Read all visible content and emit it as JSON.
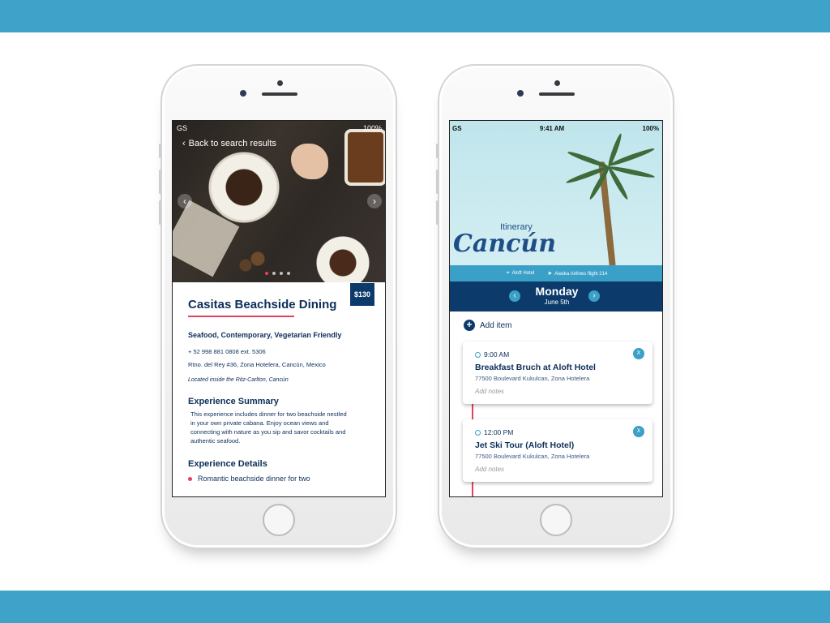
{
  "colors": {
    "band": "#3fa3c9",
    "navy": "#0c3b6b",
    "accent_pink": "#e6405f",
    "accent_blue": "#3aa0c8"
  },
  "phone1": {
    "status": {
      "carrier": "GS",
      "battery": "100%"
    },
    "back_label": "Back to search results",
    "carousel": {
      "total_slides": 4,
      "active_index": 0
    },
    "price": "$130",
    "title": "Casitas Beachside Dining",
    "cuisine": "Seafood, Contemporary, Vegetarian Friendly",
    "phone": "+ 52 998 881 0808 ext. 5306",
    "address": "Rtno. del Rey #36, Zona Hotelera, Cancún, Mexico",
    "location_note": "Located inside the Ritz-Carlton, Cancún",
    "summary_heading": "Experience Summary",
    "summary_text": "This experience includes dinner for two beachside nestled in your own private cabana. Enjoy ocean views and connecting with nature as you sip and savor cocktails and authentic seafood.",
    "details_heading": "Experience Details",
    "details": [
      "Romantic beachside dinner for two"
    ]
  },
  "phone2": {
    "status": {
      "carrier": "GS",
      "time": "9:41 AM",
      "battery": "100%"
    },
    "itinerary_label": "Itinerary",
    "city": "Cancún",
    "hotel": "Aloft Hotel",
    "flight": "Alaska Airlines flight 214",
    "day": {
      "name": "Monday",
      "date": "June 5th"
    },
    "add_item_label": "Add item",
    "items": [
      {
        "time": "9:00 AM",
        "title": "Breakfast Bruch at Aloft Hotel",
        "address": "77500 Boulevard Kukulcan, Zona Hotelera",
        "notes_placeholder": "Add notes",
        "close_label": "X"
      },
      {
        "time": "12:00 PM",
        "title": "Jet Ski Tour (Aloft Hotel)",
        "address": "77500 Boulevard Kukulcan, Zona Hotelera",
        "notes_placeholder": "Add notes",
        "close_label": "X"
      }
    ]
  }
}
